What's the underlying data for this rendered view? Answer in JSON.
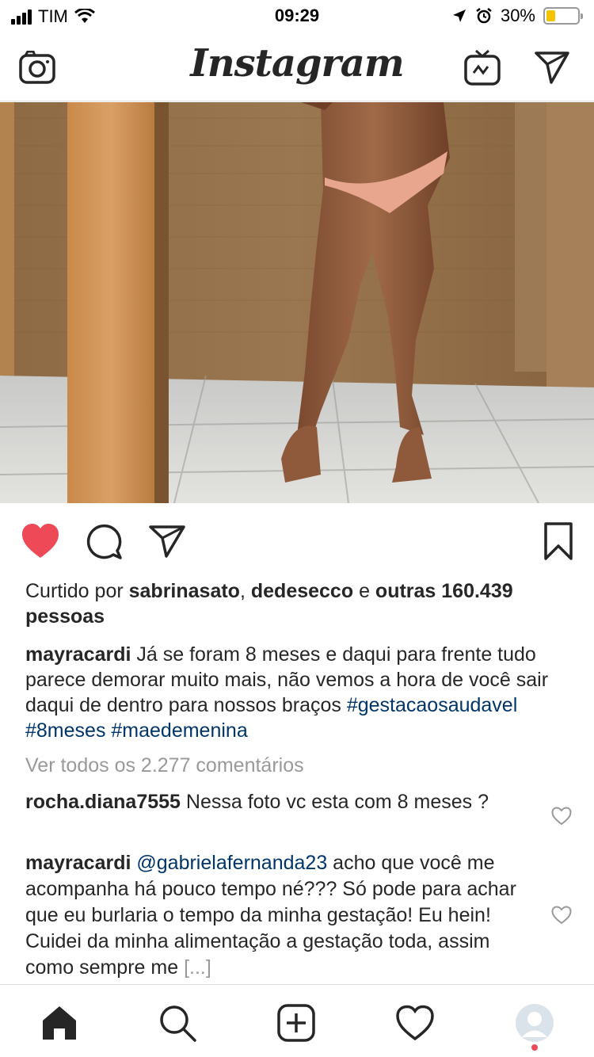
{
  "status_bar": {
    "carrier": "TIM",
    "time": "09:29",
    "battery_percent": "30%",
    "battery_level": 0.3
  },
  "header": {
    "logo": "Instagram",
    "left_icon": "camera-icon",
    "right_icons": [
      "igtv-icon",
      "direct-send-icon"
    ]
  },
  "post": {
    "liked": true,
    "likes": {
      "prefix": "Curtido por ",
      "user1": "sabrinasato",
      "sep": ", ",
      "user2": "dedesecco",
      "conj": " e ",
      "others": "outras 160.439 pessoas"
    },
    "caption": {
      "user": "mayracardi",
      "text": " Já se foram 8 meses e daqui para frente tudo parece demorar muito mais, não vemos a hora de você sair daqui de dentro para nossos braços ",
      "hashtags": "#gestacaosaudavel #8meses #maedemenina"
    },
    "view_comments": "Ver todos os 2.277 comentários",
    "comments": [
      {
        "user": "rocha.diana7555",
        "text": " Nessa foto vc esta com 8 meses ?"
      },
      {
        "user": "mayracardi",
        "mention": "@gabrielafernanda23",
        "text": " acho que você me acompanha há pouco tempo né??? Só pode para achar que eu burlaria o tempo da minha gestação! Eu hein! Cuidei da minha alimentação a gestação toda, assim como sempre me ",
        "more": "[...]"
      }
    ]
  },
  "tab_bar": {
    "items": [
      "home-icon",
      "search-icon",
      "add-post-icon",
      "activity-heart-icon",
      "profile-avatar"
    ]
  },
  "colors": {
    "like_red": "#ed4956",
    "hashtag_blue": "#003569",
    "muted_gray": "#999999",
    "battery_yellow": "#f5c400"
  }
}
